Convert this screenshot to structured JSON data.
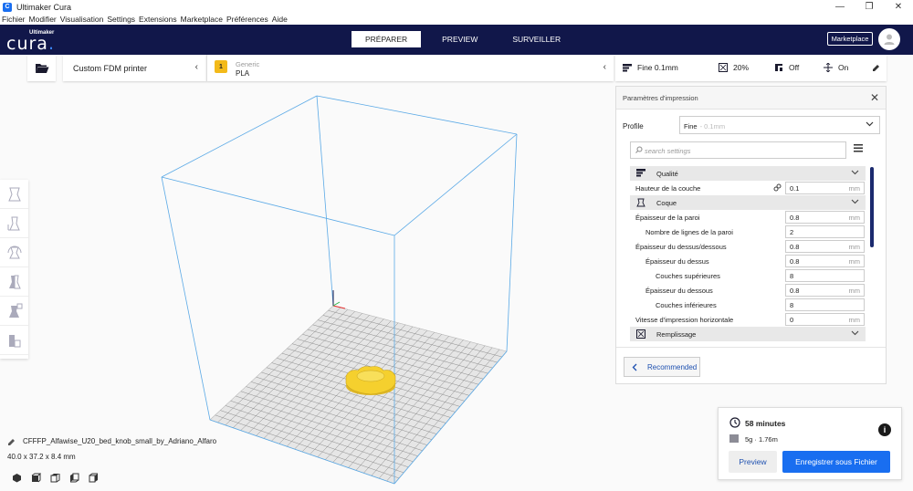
{
  "window": {
    "app_icon_letter": "C",
    "title": "Ultimaker Cura",
    "minimize": "—",
    "maximize": "❐",
    "close": "✕"
  },
  "menu": [
    "Fichier",
    "Modifier",
    "Visualisation",
    "Settings",
    "Extensions",
    "Marketplace",
    "Préférences",
    "Aide"
  ],
  "header": {
    "logo_small": "Ultimaker",
    "logo_big": "cura",
    "logo_dot": ".",
    "tabs": [
      "PRÉPARER",
      "PREVIEW",
      "SURVEILLER"
    ],
    "active_tab": "PRÉPARER",
    "marketplace_label": "Marketplace"
  },
  "printer": {
    "name": "Custom FDM printer",
    "chevron": "‹"
  },
  "material": {
    "badge": "1",
    "generic": "Generic",
    "name": "PLA",
    "chevron": "‹"
  },
  "print_setup": {
    "profile": "Fine 0.1mm",
    "infill": "20%",
    "support": "Off",
    "adhesion": "On"
  },
  "panel": {
    "title": "Paramètres d'impression",
    "close": "✕",
    "profile_label": "Profile",
    "profile_value": "Fine",
    "profile_sub": "- 0.1mm",
    "search_placeholder": "search settings",
    "recommended_label": "Recommended",
    "rows": [
      {
        "type": "category",
        "label": "Qualité",
        "icon": "quality-icon"
      },
      {
        "type": "setting",
        "label": "Hauteur de la couche",
        "value": "0.1",
        "unit": "mm",
        "indent": 0,
        "linked": true
      },
      {
        "type": "category",
        "label": "Coque",
        "icon": "shell-icon"
      },
      {
        "type": "setting",
        "label": "Épaisseur de la paroi",
        "value": "0.8",
        "unit": "mm",
        "indent": 0
      },
      {
        "type": "setting",
        "label": "Nombre de lignes de la paroi",
        "value": "2",
        "unit": "",
        "indent": 1
      },
      {
        "type": "setting",
        "label": "Épaisseur du dessus/dessous",
        "value": "0.8",
        "unit": "mm",
        "indent": 0
      },
      {
        "type": "setting",
        "label": "Épaisseur du dessus",
        "value": "0.8",
        "unit": "mm",
        "indent": 1
      },
      {
        "type": "setting",
        "label": "Couches supérieures",
        "value": "8",
        "unit": "",
        "indent": 2
      },
      {
        "type": "setting",
        "label": "Épaisseur du dessous",
        "value": "0.8",
        "unit": "mm",
        "indent": 1
      },
      {
        "type": "setting",
        "label": "Couches inférieures",
        "value": "8",
        "unit": "",
        "indent": 2
      },
      {
        "type": "setting",
        "label": "Vitesse d'impression horizontale",
        "value": "0",
        "unit": "mm",
        "indent": 0
      },
      {
        "type": "category",
        "label": "Remplissage",
        "icon": "infill-icon"
      }
    ]
  },
  "object": {
    "name": "CFFFP_Alfawise_U20_bed_knob_small_by_Adriano_Alfaro",
    "dimensions": "40.0 x 37.2 x 8.4 mm"
  },
  "summary": {
    "time": "58 minutes",
    "material": "5g · 1.76m",
    "info": "i",
    "preview_label": "Preview",
    "save_label": "Enregistrer sous Fichier"
  },
  "colors": {
    "header_bg": "#11174a",
    "accent": "#196ef0",
    "model": "#f5d02e",
    "build_volume_line": "#5aa9e6"
  }
}
